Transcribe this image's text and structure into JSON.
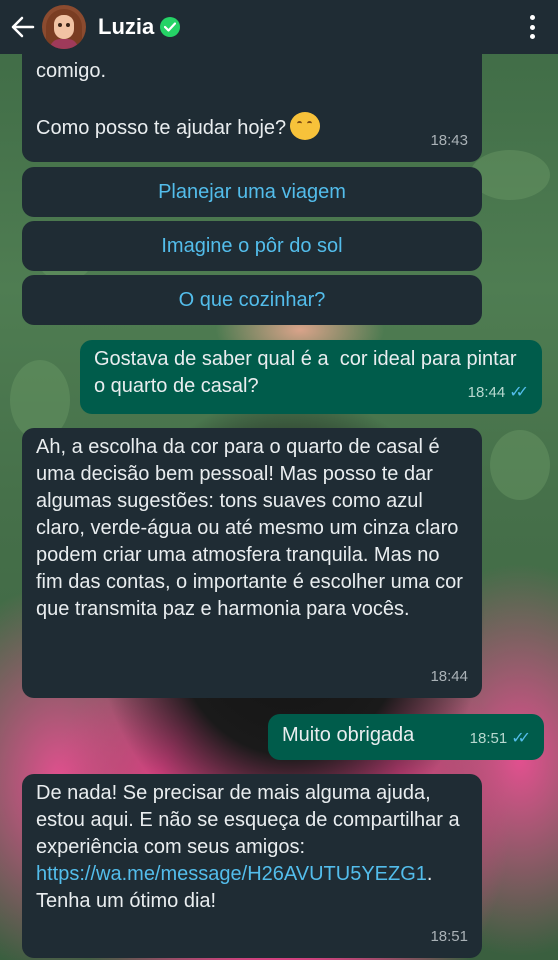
{
  "header": {
    "back_icon": "arrow-left-icon",
    "contact_name": "Luzia",
    "verified_icon": "verified-badge-icon",
    "menu_icon": "more-vertical-icon"
  },
  "messages": [
    {
      "type": "incoming",
      "text": "comigo.\n\nComo posso te ajudar hoje?",
      "emoji": "hugging-face",
      "time": "18:43"
    },
    {
      "type": "quick_reply",
      "label": "Planejar uma viagem"
    },
    {
      "type": "quick_reply",
      "label": "Imagine o pôr do sol"
    },
    {
      "type": "quick_reply",
      "label": "O que cozinhar?"
    },
    {
      "type": "outgoing",
      "text": "Gostava de saber qual é a  cor ideal para pintar o quarto de casal?",
      "time": "18:44",
      "status": "read"
    },
    {
      "type": "incoming",
      "text": "Ah, a escolha da cor para o quarto de casal é uma decisão bem pessoal! Mas posso te dar algumas sugestões: tons suaves como azul claro, verde-água ou até mesmo um cinza claro podem criar uma atmosfera tranquila. Mas no fim das contas, o importante é escolher uma cor que transmita paz e harmonia para vocês.",
      "time": "18:44"
    },
    {
      "type": "outgoing",
      "text": "Muito obrigada",
      "time": "18:51",
      "status": "read"
    },
    {
      "type": "incoming",
      "text_before": "De nada! Se precisar de mais alguma ajuda, estou aqui. E não se esqueça de compartilhar a experiência com seus amigos: ",
      "link": "https://wa.me/message/H26AVUTU5YEZG1",
      "text_after": ". Tenha um ótimo dia!",
      "time": "18:51"
    }
  ],
  "colors": {
    "header_bg": "#1f2c34",
    "incoming_bg": "#1f2c34",
    "outgoing_bg": "#005c4b",
    "link": "#53bdeb",
    "read_ticks": "#53bdeb"
  }
}
